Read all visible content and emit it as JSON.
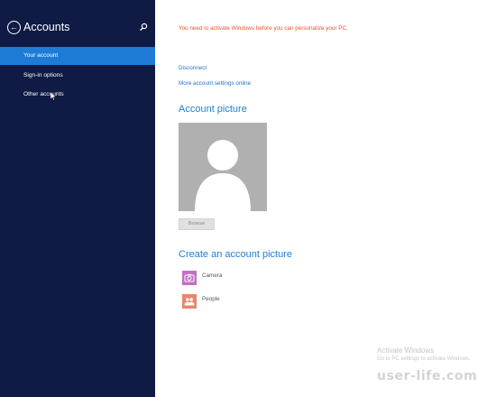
{
  "sidebar": {
    "title": "Accounts",
    "back_icon": "back-arrow-icon",
    "search_icon": "search-icon",
    "items": [
      {
        "label": "Your account",
        "selected": true
      },
      {
        "label": "Sign-in options",
        "selected": false
      },
      {
        "label": "Other accounts",
        "selected": false
      }
    ]
  },
  "main": {
    "warning": "You need to activate Windows before you can personalize your PC.",
    "links": {
      "disconnect": "Disconnect",
      "more_settings": "More account settings online"
    },
    "account_picture": {
      "title": "Account picture",
      "browse_label": "Browse"
    },
    "create_picture": {
      "title": "Create an account picture",
      "apps": [
        {
          "label": "Camera",
          "icon": "camera-icon",
          "color": "#c36fc4"
        },
        {
          "label": "People",
          "icon": "people-icon",
          "color": "#e9856b"
        }
      ]
    }
  },
  "watermark": {
    "title": "Activate Windows",
    "subtitle": "Go to PC settings to activate Windows.",
    "site": "user-life.com"
  },
  "colors": {
    "sidebar_bg": "#0f1a45",
    "selected_bg": "#1e7bd6",
    "warning": "#e8512b",
    "link": "#1e72c8"
  }
}
